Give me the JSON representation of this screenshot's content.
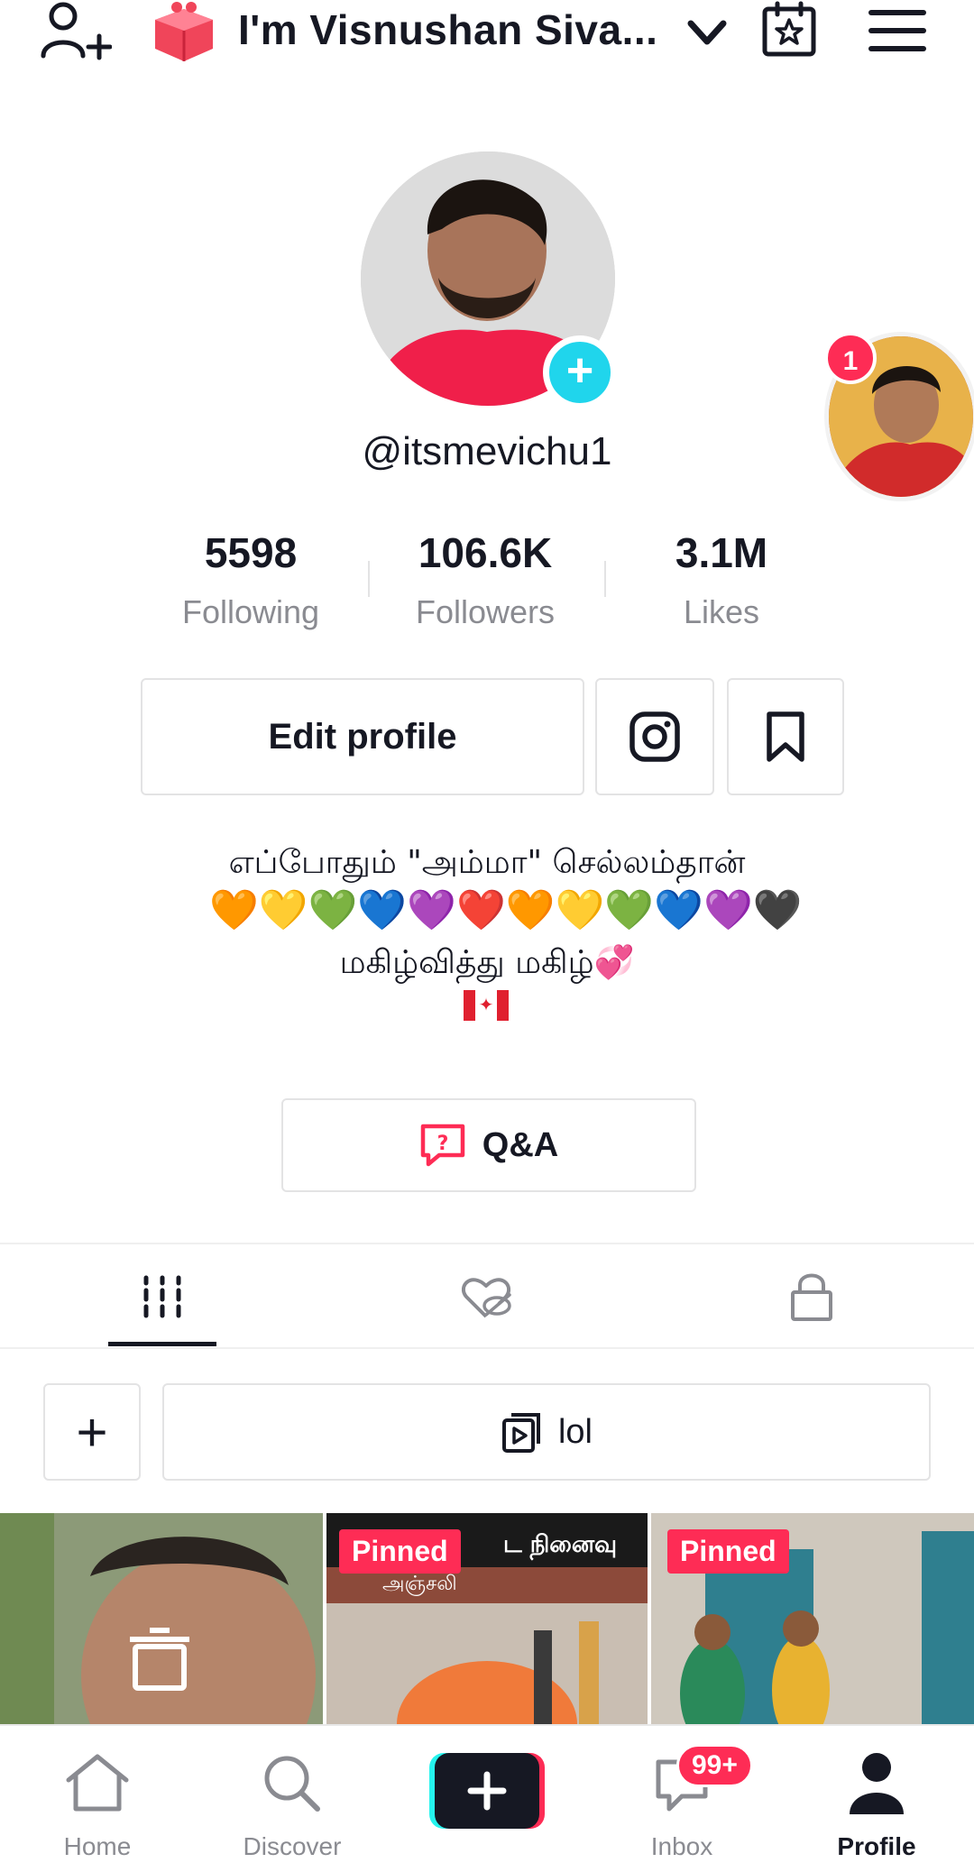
{
  "header": {
    "profile_name": "I'm Visnushan Siva...",
    "icons": [
      "add-user-icon",
      "gift-icon",
      "chevron-down-icon",
      "calendar-star-icon",
      "menu-icon"
    ]
  },
  "profile": {
    "username": "@itsmevichu1",
    "story_badge_count": "1",
    "stats": [
      {
        "value": "5598",
        "label": "Following"
      },
      {
        "value": "106.6K",
        "label": "Followers"
      },
      {
        "value": "3.1M",
        "label": "Likes"
      }
    ],
    "edit_profile_label": "Edit profile",
    "bio_line1": "எப்போதும் \"அம்மா\" செல்லம்தான்",
    "bio_hearts": [
      "🧡",
      "💛",
      "💚",
      "💙",
      "💜",
      "❤️",
      "🧡",
      "💛",
      "💚",
      "💙",
      "💜",
      "🖤"
    ],
    "bio_line3": "மகிழ்வித்து மகிழ்💞",
    "qa_label": "Q&A"
  },
  "content_tabs": [
    "videos-grid-icon",
    "liked-hidden-icon",
    "lock-icon"
  ],
  "playlist": {
    "add_label": "+",
    "name": "lol"
  },
  "videos": [
    {
      "pinned": false
    },
    {
      "pinned": true,
      "badge": "Pinned",
      "overlay_text_line1": "ட நினைவு",
      "overlay_text_line2": "அஞ்சலி"
    },
    {
      "pinned": true,
      "badge": "Pinned"
    }
  ],
  "bottom_nav": {
    "items": [
      {
        "label": "Home"
      },
      {
        "label": "Discover"
      },
      {
        "label": ""
      },
      {
        "label": "Inbox",
        "badge": "99+"
      },
      {
        "label": "Profile"
      }
    ]
  },
  "colors": {
    "accent": "#fe2c55",
    "teal": "#20d5ec",
    "text": "#161823",
    "muted": "#8a8b91"
  }
}
